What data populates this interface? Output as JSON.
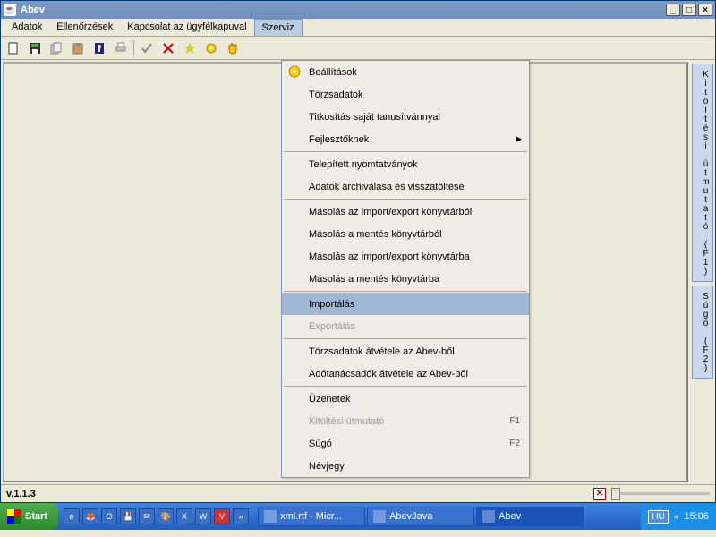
{
  "window": {
    "title": "Abev"
  },
  "menubar": {
    "items": [
      "Adatok",
      "Ellenőrzések",
      "Kapcsolat az ügyfélkapuval",
      "Szerviz"
    ],
    "open_index": 3
  },
  "dropdown": {
    "groups": [
      [
        {
          "label": "Beállítások",
          "icon": "gear-icon"
        },
        {
          "label": "Törzsadatok"
        },
        {
          "label": "Titkosítás saját tanusítvánnyal"
        },
        {
          "label": "Fejlesztőknek",
          "submenu": true
        }
      ],
      [
        {
          "label": "Telepített nyomtatványok"
        },
        {
          "label": "Adatok archiválása és visszatöltése"
        }
      ],
      [
        {
          "label": "Másolás az import/export könyvtárból"
        },
        {
          "label": "Másolás a mentés könyvtárból"
        },
        {
          "label": "Másolás az import/export könyvtárba"
        },
        {
          "label": "Másolás a mentés könyvtárba"
        }
      ],
      [
        {
          "label": "Importálás",
          "highlight": true
        },
        {
          "label": "Exportálás",
          "disabled": true
        }
      ],
      [
        {
          "label": "Törzsadatok átvétele az Abev-ből"
        },
        {
          "label": "Adótanácsadók átvétele az Abev-ből"
        }
      ],
      [
        {
          "label": "Üzenetek"
        },
        {
          "label": "Kitöltési útmutató",
          "disabled": true,
          "accel": "F1"
        },
        {
          "label": "Súgó",
          "accel": "F2"
        },
        {
          "label": "Névjegy"
        }
      ]
    ]
  },
  "sidetabs": {
    "guide": "Kitöltési útmutató (F1)",
    "help": "Súgó (F2)"
  },
  "status": {
    "version": "v.1.1.3"
  },
  "taskbar": {
    "start": "Start",
    "tasks": [
      {
        "label": "xml.rtf - Micr..."
      },
      {
        "label": "AbevJava"
      },
      {
        "label": "Abev",
        "active": true
      }
    ],
    "clock": "15:06",
    "lang": "HU"
  },
  "toolbar_icons": [
    "new-icon",
    "save-icon",
    "copy-icon",
    "paste-icon",
    "key-icon",
    "print-icon",
    "check-icon",
    "cancel-icon",
    "star-icon",
    "gear-yellow-icon",
    "hand-icon"
  ]
}
